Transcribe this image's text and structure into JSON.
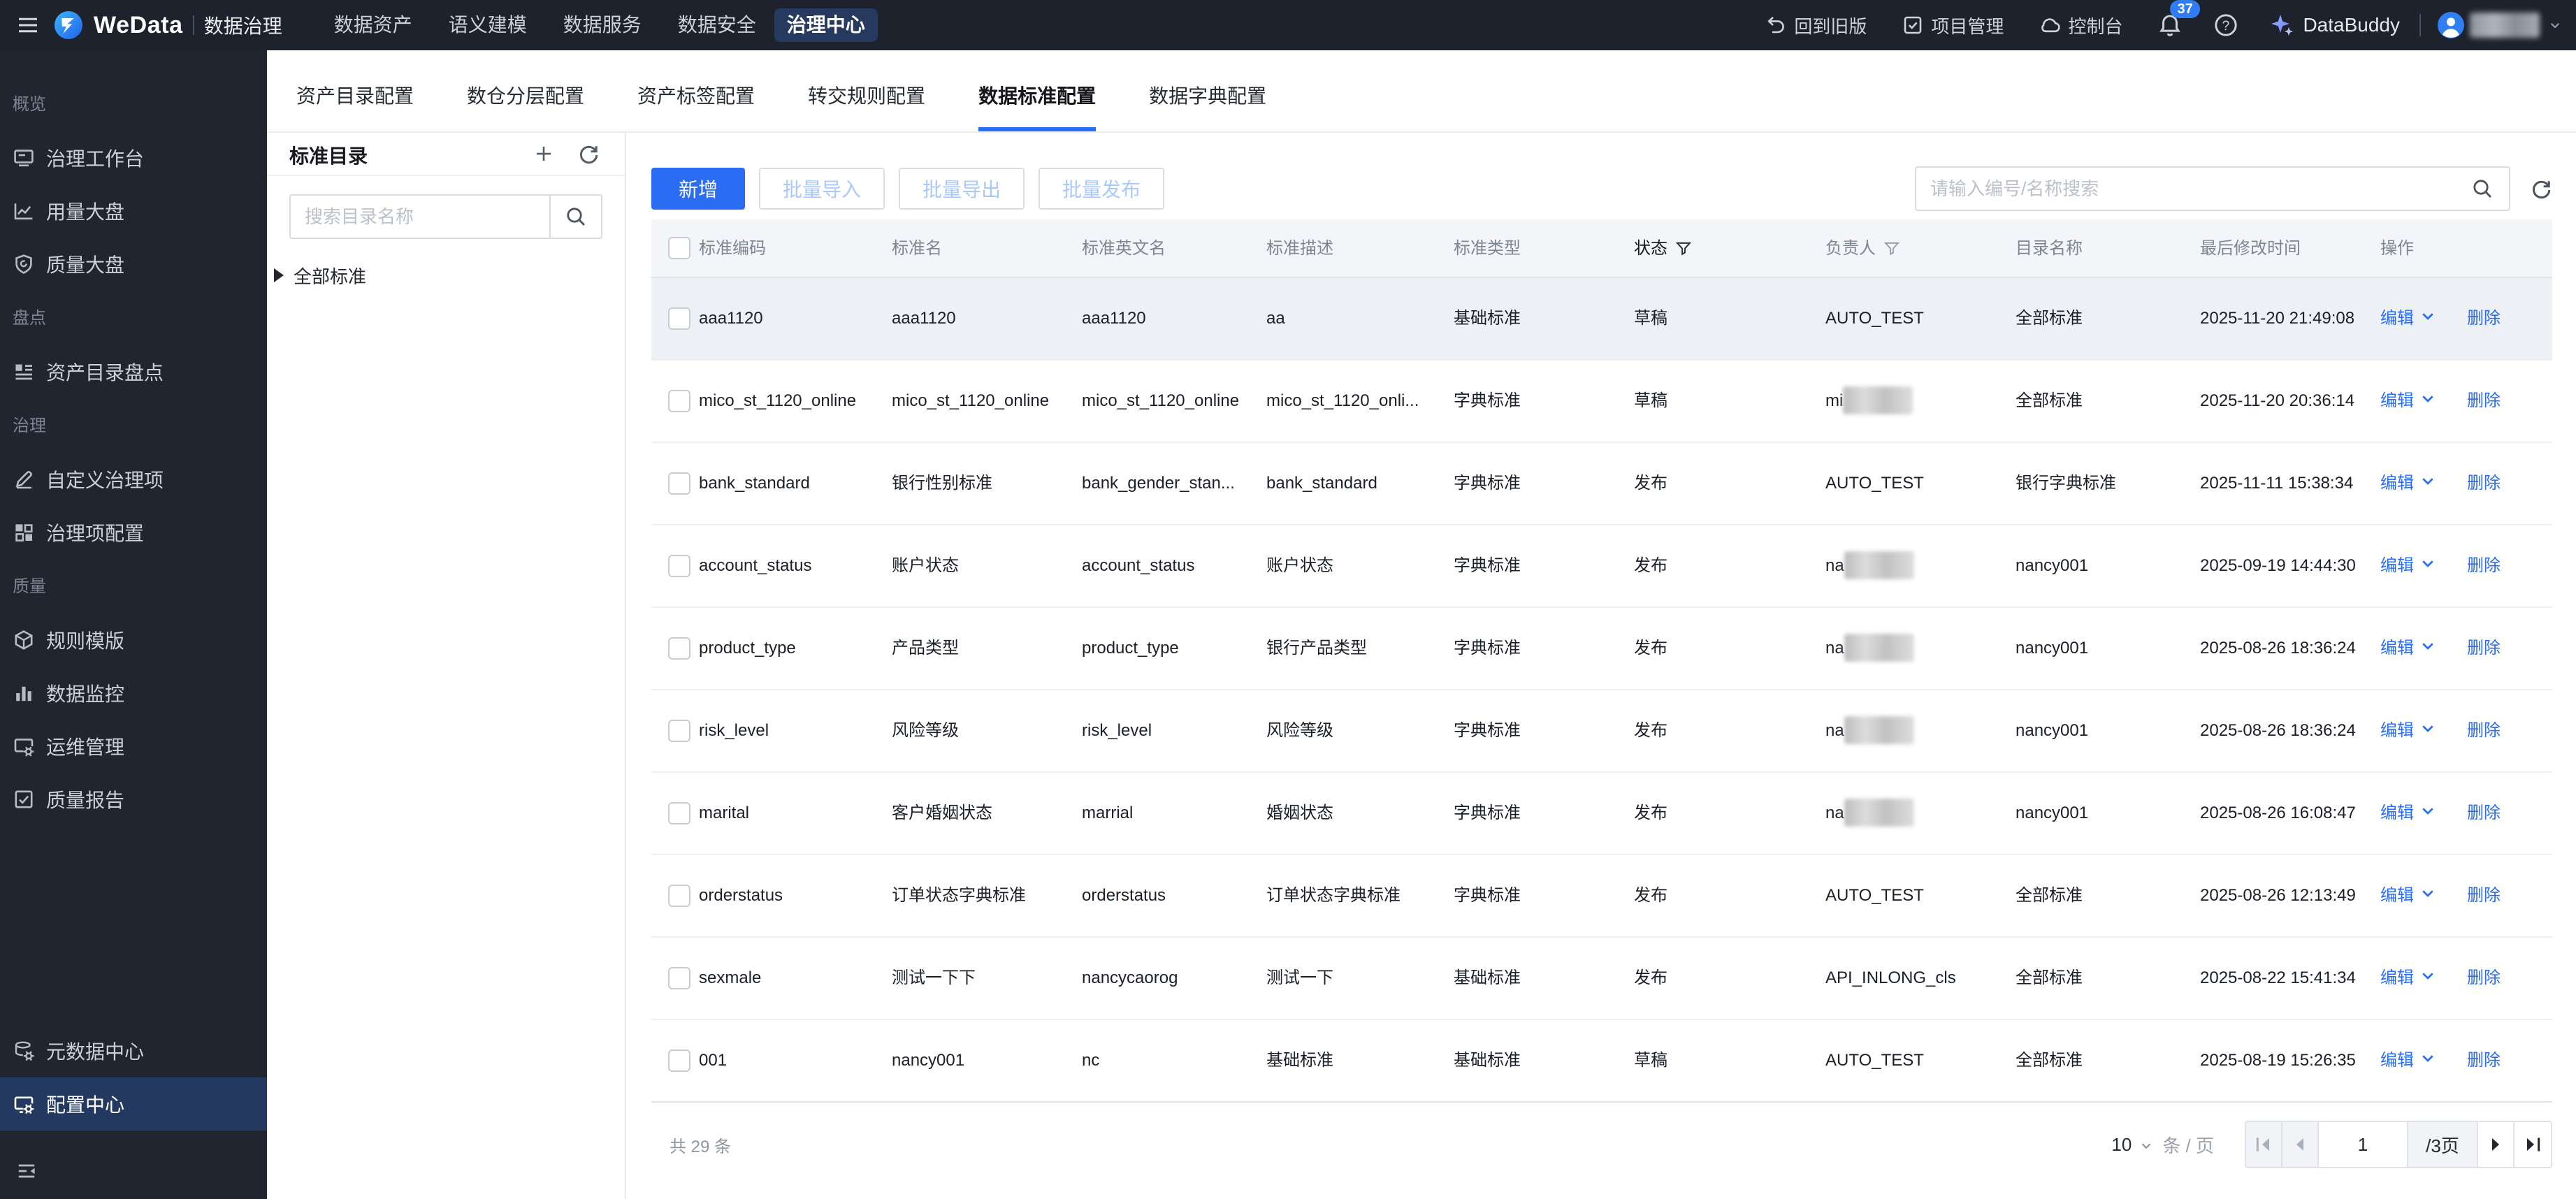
{
  "topbar": {
    "brand": "WeData",
    "product": "数据治理",
    "nav": [
      {
        "label": "数据资产"
      },
      {
        "label": "语义建模"
      },
      {
        "label": "数据服务"
      },
      {
        "label": "数据安全"
      },
      {
        "label": "治理中心",
        "active": true
      }
    ],
    "actions": [
      {
        "label": "回到旧版",
        "icon": "undo-icon"
      },
      {
        "label": "项目管理",
        "icon": "project-icon"
      },
      {
        "label": "控制台",
        "icon": "console-icon"
      }
    ],
    "notification_count": "37",
    "databuddy_label": "DataBuddy"
  },
  "sidebar": {
    "groups": [
      {
        "label": "概览",
        "items": [
          {
            "label": "治理工作台",
            "icon": "workbench"
          },
          {
            "label": "用量大盘",
            "icon": "usage-chart"
          },
          {
            "label": "质量大盘",
            "icon": "quality-shield"
          }
        ]
      },
      {
        "label": "盘点",
        "items": [
          {
            "label": "资产目录盘点",
            "icon": "catalog-audit"
          }
        ]
      },
      {
        "label": "治理",
        "items": [
          {
            "label": "自定义治理项",
            "icon": "custom-governance"
          },
          {
            "label": "治理项配置",
            "icon": "governance-config"
          }
        ]
      },
      {
        "label": "质量",
        "items": [
          {
            "label": "规则模版",
            "icon": "rule-template"
          },
          {
            "label": "数据监控",
            "icon": "data-monitor"
          },
          {
            "label": "运维管理",
            "icon": "ops-manage"
          },
          {
            "label": "质量报告",
            "icon": "quality-report"
          }
        ]
      }
    ],
    "bottom_items": [
      {
        "label": "元数据中心",
        "icon": "metadata-center"
      },
      {
        "label": "配置中心",
        "icon": "config-center",
        "active": true
      }
    ]
  },
  "tabs": [
    {
      "label": "资产目录配置"
    },
    {
      "label": "数仓分层配置"
    },
    {
      "label": "资产标签配置"
    },
    {
      "label": "转交规则配置"
    },
    {
      "label": "数据标准配置",
      "active": true
    },
    {
      "label": "数据字典配置"
    }
  ],
  "panel": {
    "title": "标准目录",
    "search_placeholder": "搜索目录名称",
    "tree": [
      {
        "label": "全部标准"
      }
    ]
  },
  "toolbar": {
    "add_label": "新增",
    "batch_import_label": "批量导入",
    "batch_export_label": "批量导出",
    "batch_publish_label": "批量发布",
    "search_placeholder": "请输入编号/名称搜索"
  },
  "table": {
    "columns": [
      "标准编码",
      "标准名",
      "标准英文名",
      "标准描述",
      "标准类型",
      "状态",
      "负责人",
      "目录名称",
      "最后修改时间",
      "操作"
    ],
    "edit_label": "编辑",
    "delete_label": "删除",
    "rows": [
      {
        "code": "aaa1120",
        "name": "aaa1120",
        "ename": "aaa1120",
        "desc": "aa",
        "type": "基础标准",
        "status": "草稿",
        "owner": "AUTO_TEST",
        "owner_blurred": false,
        "catalog": "全部标准",
        "mtime": "2025-11-20 21:49:08",
        "selected": true
      },
      {
        "code": "mico_st_1120_online",
        "name": "mico_st_1120_online",
        "ename": "mico_st_1120_online",
        "desc": "mico_st_1120_onli...",
        "type": "字典标准",
        "status": "草稿",
        "owner": "mi",
        "owner_blurred": true,
        "catalog": "全部标准",
        "mtime": "2025-11-20 20:36:14"
      },
      {
        "code": "bank_standard",
        "name": "银行性别标准",
        "ename": "bank_gender_stan...",
        "desc": "bank_standard",
        "type": "字典标准",
        "status": "发布",
        "owner": "AUTO_TEST",
        "owner_blurred": false,
        "catalog": "银行字典标准",
        "mtime": "2025-11-11 15:38:34"
      },
      {
        "code": "account_status",
        "name": "账户状态",
        "ename": "account_status",
        "desc": "账户状态",
        "type": "字典标准",
        "status": "发布",
        "owner": "na",
        "owner_blurred": true,
        "catalog": "nancy001",
        "mtime": "2025-09-19 14:44:30"
      },
      {
        "code": "product_type",
        "name": "产品类型",
        "ename": "product_type",
        "desc": "银行产品类型",
        "type": "字典标准",
        "status": "发布",
        "owner": "na",
        "owner_blurred": true,
        "catalog": "nancy001",
        "mtime": "2025-08-26 18:36:24"
      },
      {
        "code": "risk_level",
        "name": "风险等级",
        "ename": "risk_level",
        "desc": "风险等级",
        "type": "字典标准",
        "status": "发布",
        "owner": "na",
        "owner_blurred": true,
        "catalog": "nancy001",
        "mtime": "2025-08-26 18:36:24"
      },
      {
        "code": "marital",
        "name": "客户婚姻状态",
        "ename": "marrial",
        "desc": "婚姻状态",
        "type": "字典标准",
        "status": "发布",
        "owner": "na",
        "owner_blurred": true,
        "catalog": "nancy001",
        "mtime": "2025-08-26 16:08:47"
      },
      {
        "code": "orderstatus",
        "name": "订单状态字典标准",
        "ename": "orderstatus",
        "desc": "订单状态字典标准",
        "type": "字典标准",
        "status": "发布",
        "owner": "AUTO_TEST",
        "owner_blurred": false,
        "catalog": "全部标准",
        "mtime": "2025-08-26 12:13:49"
      },
      {
        "code": "sexmale",
        "name": "测试一下下",
        "ename": "nancycaorog",
        "desc": "测试一下",
        "type": "基础标准",
        "status": "发布",
        "owner": "API_INLONG_cls",
        "owner_blurred": false,
        "catalog": "全部标准",
        "mtime": "2025-08-22 15:41:34"
      },
      {
        "code": "001",
        "name": "nancy001",
        "ename": "nc",
        "desc": "基础标准",
        "type": "基础标准",
        "status": "草稿",
        "owner": "AUTO_TEST",
        "owner_blurred": false,
        "catalog": "全部标准",
        "mtime": "2025-08-19 15:26:35"
      }
    ]
  },
  "footer": {
    "total_label": "共 29 条",
    "page_size": "10",
    "page_size_unit": "条 / 页",
    "current_page": "1",
    "total_pages": "/3页"
  }
}
